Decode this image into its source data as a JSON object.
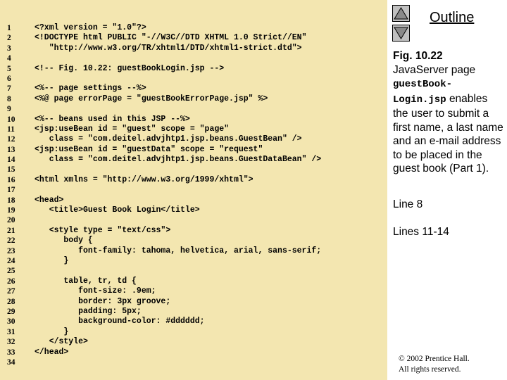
{
  "code": {
    "line_numbers": [
      "1",
      "2",
      "3",
      "4",
      "5",
      "6",
      "7",
      "8",
      "9",
      "10",
      "11",
      "12",
      "13",
      "14",
      "15",
      "16",
      "17",
      "18",
      "19",
      "20",
      "21",
      "22",
      "23",
      "24",
      "25",
      "26",
      "27",
      "28",
      "29",
      "30",
      "31",
      "32",
      "33",
      "34"
    ],
    "lines": [
      "<?xml version = \"1.0\"?>",
      "<!DOCTYPE html PUBLIC \"-//W3C//DTD XHTML 1.0 Strict//EN\"",
      "   \"http://www.w3.org/TR/xhtml1/DTD/xhtml1-strict.dtd\">",
      "",
      "<!-- Fig. 10.22: guestBookLogin.jsp -->",
      "",
      "<%-- page settings --%>",
      "<%@ page errorPage = \"guestBookErrorPage.jsp\" %>",
      "",
      "<%-- beans used in this JSP --%>",
      "<jsp:useBean id = \"guest\" scope = \"page\"",
      "   class = \"com.deitel.advjhtp1.jsp.beans.GuestBean\" />",
      "<jsp:useBean id = \"guestData\" scope = \"request\"",
      "   class = \"com.deitel.advjhtp1.jsp.beans.GuestDataBean\" />",
      "",
      "<html xmlns = \"http://www.w3.org/1999/xhtml\">",
      "",
      "<head>",
      "   <title>Guest Book Login</title>",
      "",
      "   <style type = \"text/css\">",
      "      body {",
      "         font-family: tahoma, helvetica, arial, sans-serif;",
      "      }",
      "",
      "      table, tr, td {",
      "         font-size: .9em;",
      "         border: 3px groove;",
      "         padding: 5px;",
      "         background-color: #dddddd;",
      "      }",
      "   </style>",
      "</head>",
      ""
    ]
  },
  "sidebar": {
    "outline_title": "Outline",
    "caption": {
      "fig_number": "Fig. 10.22",
      "text1": "JavaServer page",
      "mono": "guestBook-Login.jsp",
      "text2": "enables the user to submit a first name, a last name and an e-mail address to be placed in the guest book (Part 1)."
    },
    "labels": [
      "Line 8",
      "Lines 11-14"
    ],
    "copyright_line1": "© 2002 Prentice Hall.",
    "copyright_line2": "All rights reserved."
  },
  "nav": {
    "up_icon": "triangle-up-icon",
    "down_icon": "triangle-down-icon"
  },
  "colors": {
    "code_background": "#f3e6b0",
    "nav_button": "#c0c0c0"
  }
}
